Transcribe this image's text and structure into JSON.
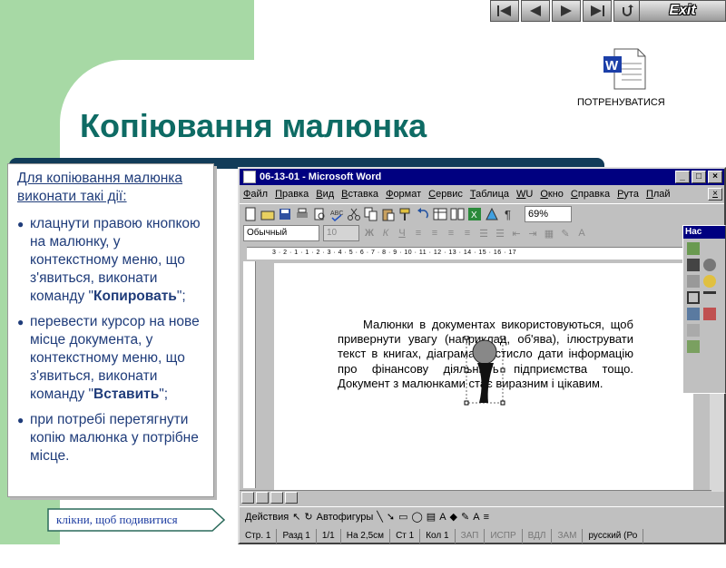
{
  "nav": {
    "exit_label": "Exit",
    "practice_label": "ПОТРЕНУВАТИСЯ",
    "hint_label": "клікни, щоб подивитися"
  },
  "slide": {
    "title": "Копіювання малюнка"
  },
  "instructions": {
    "heading": "Для копіювання малюнка виконати такі дії:",
    "step1_pre": "клацнути правою кнопкою на малюнку, у контекстному меню, що з'явиться, виконати команду \"",
    "step1_cmd": "Копировать",
    "step1_post": "\";",
    "step2_pre": "перевести курсор на нове місце документа, у контекстному меню, що з'явиться, виконати команду \"",
    "step2_cmd": "Вставить",
    "step2_post": "\";",
    "step3": "при потребі перетягнути копію малюнка у потрібне місце."
  },
  "word": {
    "window_title": "06-13-01 - Microsoft Word",
    "menu": [
      "Файл",
      "Правка",
      "Вид",
      "Вставка",
      "Формат",
      "Сервис",
      "Таблица",
      "WU",
      "Окно",
      "Справка",
      "Рута",
      "Плай"
    ],
    "zoom": "69%",
    "style": "Обычный",
    "font_size": "10",
    "ruler": "3 · 2 · 1 · 1 · 2 · 3 · 4 · 5 · 6 · 7 · 8 · 9 · 10 · 11 · 12 · 13 · 14 · 15 · 16 · 17",
    "doc_text": "Малюнки в документах використовуються, щоб привернути увагу (наприклад, об'ява), ілюструвати текст в книгах, діаграмами стисло дати інформацію про фінансову діяльність підприємства тощо. Документ з малюнками стає виразним і цікавим.",
    "draw_actions": "Действия",
    "draw_autoshapes": "Автофигуры",
    "status": [
      "Стр. 1",
      "Разд 1",
      "1/1",
      "На 2,5см",
      "Ст 1",
      "Кол 1",
      "ЗАП",
      "ИСПР",
      "ВДЛ",
      "ЗАМ",
      "русский (Ро"
    ],
    "panel_title": "Нас"
  },
  "colors": {
    "title": "#0e6b64",
    "instruction_text": "#1f3c7a",
    "slide_green": "#a7d9a5",
    "word_titlebar": "#000080"
  }
}
